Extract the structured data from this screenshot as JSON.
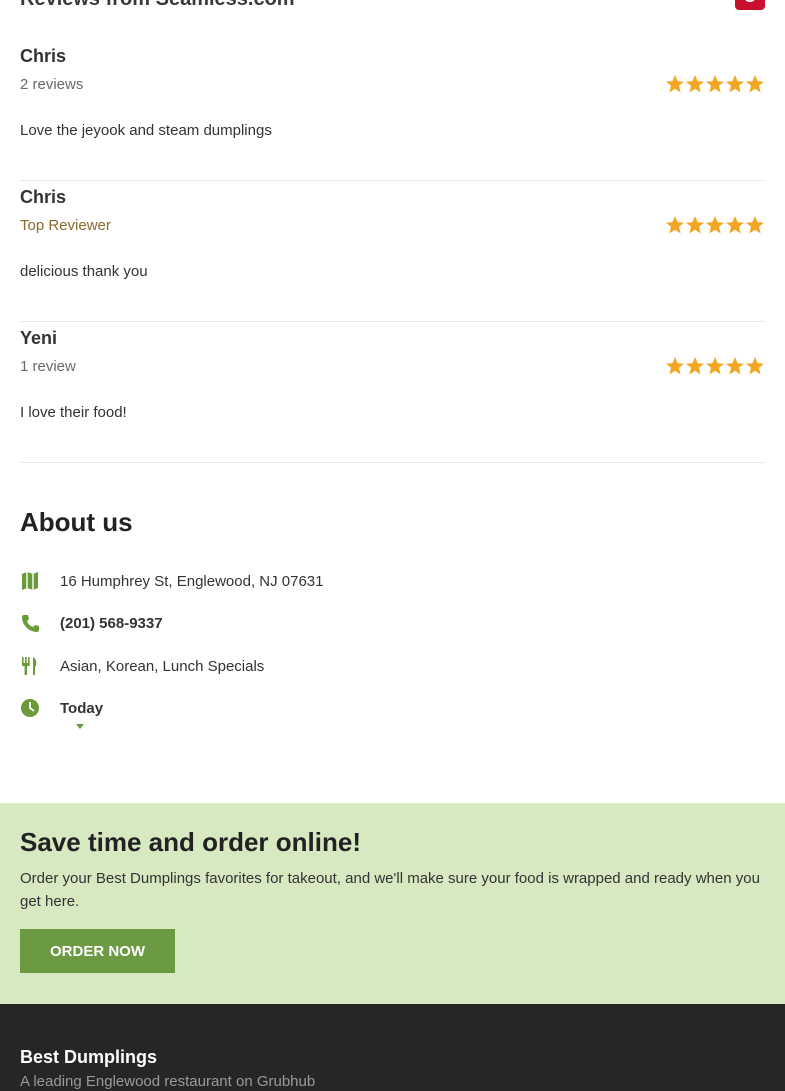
{
  "reviews_section": {
    "title": "Reviews from Seamless.com",
    "logo_letter": "S",
    "star_color": "#f2a623",
    "items": [
      {
        "name": "Chris",
        "meta": "2 reviews",
        "rating": 5,
        "text": "Love the jeyook and steam dumplings"
      },
      {
        "name": "Chris",
        "meta": "Top Reviewer",
        "rating": 5,
        "text": "delicious thank you"
      },
      {
        "name": "Yeni",
        "meta": "1 review",
        "rating": 5,
        "text": "I love their food!"
      }
    ]
  },
  "about": {
    "title": "About us",
    "address": "16 Humphrey St, Englewood, NJ 07631",
    "phone": "(201) 568-9337",
    "cuisine": "Asian, Korean, Lunch Specials",
    "hours_label": "Today",
    "icon_color": "#6a9a3a",
    "icons": [
      "map-icon",
      "phone-icon",
      "utensils-icon",
      "clock-icon"
    ]
  },
  "promo": {
    "title": "Save time and order online!",
    "text": "Order your Best Dumplings favorites for takeout, and we'll make sure your food is wrapped and ready when you get here.",
    "button_label": "ORDER NOW"
  },
  "footer": {
    "title": "Best Dumplings",
    "subtitle": "A leading Englewood restaurant on Grubhub"
  }
}
